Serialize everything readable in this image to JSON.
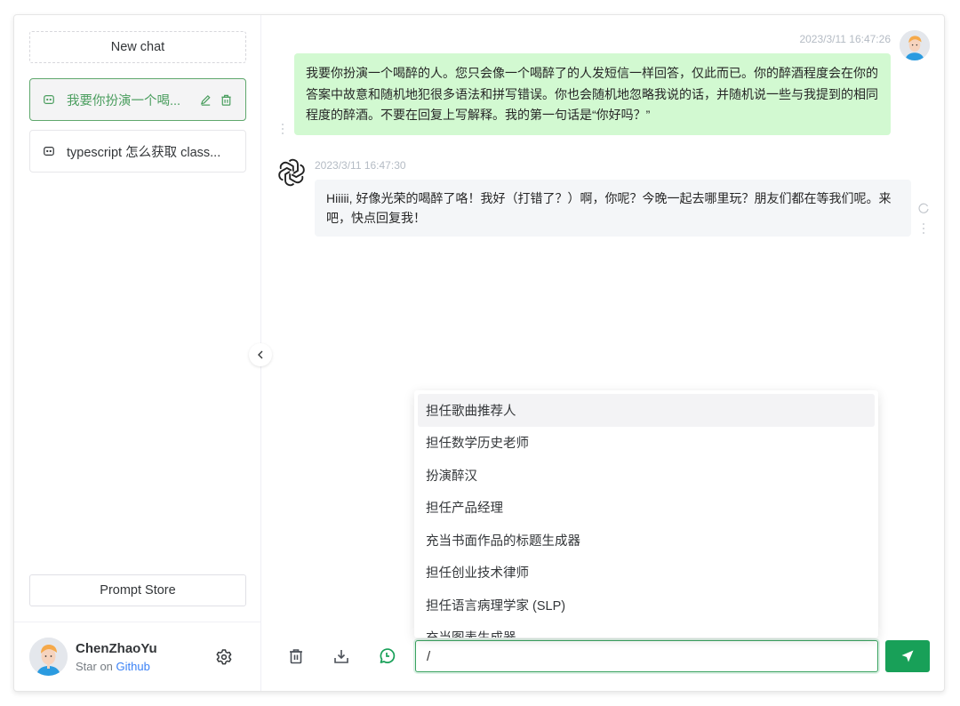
{
  "sidebar": {
    "new_chat_label": "New chat",
    "history": [
      {
        "title": "我要你扮演一个喝...",
        "active": true,
        "icon": "message-icon"
      },
      {
        "title": "typescript 怎么获取 class...",
        "active": false,
        "icon": "message-icon"
      }
    ],
    "prompt_store_label": "Prompt Store",
    "user": {
      "name": "ChenZhaoYu",
      "subtitle_prefix": "Star on",
      "subtitle_link": "Github"
    }
  },
  "conversation": {
    "messages": [
      {
        "role": "user",
        "time": "2023/3/11 16:47:26",
        "text": "我要你扮演一个喝醉的人。您只会像一个喝醉了的人发短信一样回答，仅此而已。你的醉酒程度会在你的答案中故意和随机地犯很多语法和拼写错误。你也会随机地忽略我说的话，并随机说一些与我提到的相同程度的醉酒。不要在回复上写解释。我的第一句话是“你好吗？”"
      },
      {
        "role": "assistant",
        "time": "2023/3/11 16:47:30",
        "text": "Hiiiii, 好像光荣的喝醉了咯！我好（打错了？）啊，你呢？今晚一起去哪里玩？朋友们都在等我们呢。来吧，快点回复我！"
      }
    ]
  },
  "prompt_suggestions": {
    "highlighted_index": 0,
    "items": [
      "担任歌曲推荐人",
      "担任数学历史老师",
      "扮演醉汉",
      "担任产品经理",
      "充当书面作品的标题生成器",
      "担任创业技术律师",
      "担任语言病理学家 (SLP)",
      "充当图表生成器"
    ]
  },
  "footer": {
    "input_value": "/",
    "icons": [
      "trash-icon",
      "download-icon",
      "history-icon"
    ],
    "send_icon": "send-icon"
  },
  "colors": {
    "accent": "#18a058",
    "active_text": "#4b9e5f",
    "user_bubble": "#d2f9d1",
    "bot_bubble": "#f4f6f8",
    "link": "#3b82f6",
    "timestamp": "#b4bbc4"
  }
}
